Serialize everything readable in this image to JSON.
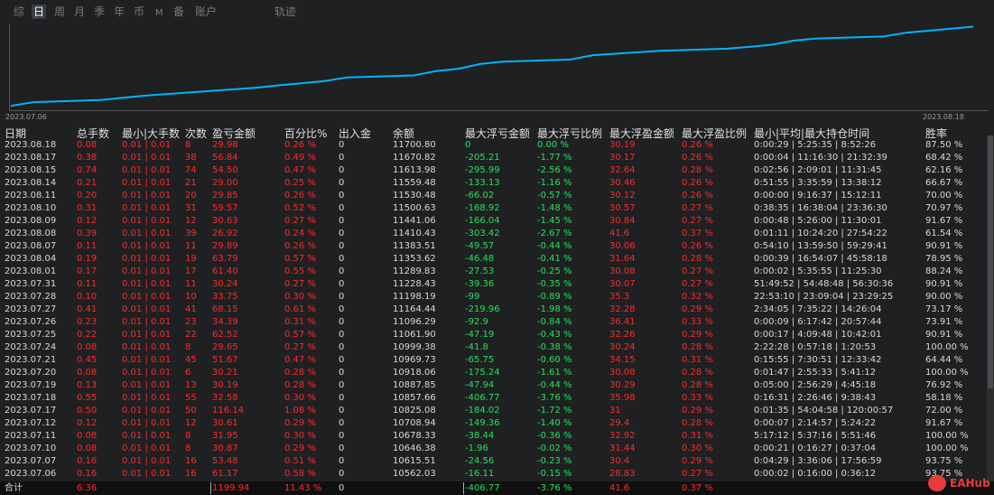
{
  "tabs": [
    "综",
    "日",
    "周",
    "月",
    "季",
    "年",
    "币",
    "M",
    "备",
    "账户",
    "轨迹"
  ],
  "active_tab": "日",
  "chart_data": {
    "type": "line",
    "x_start_label": "2023.07.06",
    "x_end_label": "2023.08.18",
    "x": [
      "2023.07.06",
      "2023.07.07",
      "2023.07.10",
      "2023.07.11",
      "2023.07.12",
      "2023.07.17",
      "2023.07.18",
      "2023.07.19",
      "2023.07.20",
      "2023.07.21",
      "2023.07.24",
      "2023.07.25",
      "2023.07.26",
      "2023.07.27",
      "2023.07.28",
      "2023.07.31",
      "2023.08.01",
      "2023.08.04",
      "2023.08.07",
      "2023.08.08",
      "2023.08.09",
      "2023.08.10",
      "2023.08.11",
      "2023.08.14",
      "2023.08.15",
      "2023.08.17",
      "2023.08.18"
    ],
    "values": [
      10562.03,
      10615.51,
      10646.38,
      10678.33,
      10708.94,
      10825.08,
      10857.66,
      10887.85,
      10918.06,
      10969.73,
      10999.38,
      11061.9,
      11096.29,
      11164.44,
      11198.19,
      11228.43,
      11289.83,
      11353.62,
      11383.51,
      11410.43,
      11441.06,
      11500.63,
      11530.48,
      11559.48,
      11613.98,
      11670.82,
      11700.8
    ],
    "line_color": "#00b4ff"
  },
  "headers": [
    "日期",
    "总手数",
    "最小|大手数",
    "次数",
    "盈亏金额",
    "百分比%",
    "出入金",
    "余额",
    "最大浮亏金额",
    "最大浮亏比例",
    "最大浮盈金额",
    "最大浮盈比例",
    "最小|平均|最大持仓时间",
    "胜率"
  ],
  "rows": [
    [
      "2023.08.18",
      "0.08",
      "0.01 | 0.01",
      "8",
      "29.98",
      "0.26 %",
      "0",
      "11700.80",
      "0",
      "0.00 %",
      "30.19",
      "0.26 %",
      "0:00:29 | 5:25:35 | 8:52:26",
      "87.50 %"
    ],
    [
      "2023.08.17",
      "0.38",
      "0.01 | 0.01",
      "38",
      "56.84",
      "0.49 %",
      "0",
      "11670.82",
      "-205.21",
      "-1.77 %",
      "30.17",
      "0.26 %",
      "0:00:04 | 11:16:30 | 21:32:39",
      "68.42 %"
    ],
    [
      "2023.08.15",
      "0.74",
      "0.01 | 0.01",
      "74",
      "54.50",
      "0.47 %",
      "0",
      "11613.98",
      "-295.99",
      "-2.56 %",
      "32.64",
      "0.28 %",
      "0:02:56 | 2:09:01 | 11:31:45",
      "62.16 %"
    ],
    [
      "2023.08.14",
      "0.21",
      "0.01 | 0.01",
      "21",
      "29.00",
      "0.25 %",
      "0",
      "11559.48",
      "-133.13",
      "-1.16 %",
      "30.46",
      "0.26 %",
      "0:51:55 | 3:35:59 | 13:38:12",
      "66.67 %"
    ],
    [
      "2023.08.11",
      "0.20",
      "0.01 | 0.01",
      "20",
      "29.85",
      "0.26 %",
      "0",
      "11530.48",
      "-66.02",
      "-0.57 %",
      "30.12",
      "0.26 %",
      "0:00:00 | 9:16:37 | 15:12:11",
      "70.00 %"
    ],
    [
      "2023.08.10",
      "0.31",
      "0.01 | 0.01",
      "31",
      "59.57",
      "0.52 %",
      "0",
      "11500.63",
      "-168.92",
      "-1.48 %",
      "30.57",
      "0.27 %",
      "0:38:35 | 16:38:04 | 23:36:30",
      "70.97 %"
    ],
    [
      "2023.08.09",
      "0.12",
      "0.01 | 0.01",
      "12",
      "30.63",
      "0.27 %",
      "0",
      "11441.06",
      "-166.04",
      "-1.45 %",
      "30.84",
      "0.27 %",
      "0:00:48 | 5:26:00 | 11:30:01",
      "91.67 %"
    ],
    [
      "2023.08.08",
      "0.39",
      "0.01 | 0.01",
      "39",
      "26.92",
      "0.24 %",
      "0",
      "11410.43",
      "-303.42",
      "-2.67 %",
      "41.6",
      "0.37 %",
      "0:01:11 | 10:24:20 | 27:54:22",
      "61.54 %"
    ],
    [
      "2023.08.07",
      "0.11",
      "0.01 | 0.01",
      "11",
      "29.89",
      "0.26 %",
      "0",
      "11383.51",
      "-49.57",
      "-0.44 %",
      "30.06",
      "0.26 %",
      "0:54:10 | 13:59:50 | 59:29:41",
      "90.91 %"
    ],
    [
      "2023.08.04",
      "0.19",
      "0.01 | 0.01",
      "19",
      "63.79",
      "0.57 %",
      "0",
      "11353.62",
      "-46.48",
      "-0.41 %",
      "31.64",
      "0.28 %",
      "0:00:39 | 16:54:07 | 45:58:18",
      "78.95 %"
    ],
    [
      "2023.08.01",
      "0.17",
      "0.01 | 0.01",
      "17",
      "61.40",
      "0.55 %",
      "0",
      "11289.83",
      "-27.53",
      "-0.25 %",
      "30.08",
      "0.27 %",
      "0:00:02 | 5:35:55 | 11:25:30",
      "88.24 %"
    ],
    [
      "2023.07.31",
      "0.11",
      "0.01 | 0.01",
      "11",
      "30.24",
      "0.27 %",
      "0",
      "11228.43",
      "-39.36",
      "-0.35 %",
      "30.07",
      "0.27 %",
      "51:49:52 | 54:48:48 | 56:30:36",
      "90.91 %"
    ],
    [
      "2023.07.28",
      "0.10",
      "0.01 | 0.01",
      "10",
      "33.75",
      "0.30 %",
      "0",
      "11198.19",
      "-99",
      "-0.89 %",
      "35.3",
      "0.32 %",
      "22:53:10 | 23:09:04 | 23:29:25",
      "90.00 %"
    ],
    [
      "2023.07.27",
      "0.41",
      "0.01 | 0.01",
      "41",
      "68.15",
      "0.61 %",
      "0",
      "11164.44",
      "-219.96",
      "-1.98 %",
      "32.28",
      "0.29 %",
      "2:34:05 | 7:35:22 | 14:26:04",
      "73.17 %"
    ],
    [
      "2023.07.26",
      "0.23",
      "0.01 | 0.01",
      "23",
      "34.39",
      "0.31 %",
      "0",
      "11096.29",
      "-92.9",
      "-0.84 %",
      "36.41",
      "0.33 %",
      "0:00:09 | 6:17:42 | 20:57:44",
      "73.91 %"
    ],
    [
      "2023.07.25",
      "0.22",
      "0.01 | 0.01",
      "22",
      "62.52",
      "0.57 %",
      "0",
      "11061.90",
      "-47.19",
      "-0.43 %",
      "32.26",
      "0.29 %",
      "0:00:17 | 4:09:48 | 10:42:01",
      "90.91 %"
    ],
    [
      "2023.07.24",
      "0.08",
      "0.01 | 0.01",
      "8",
      "29.65",
      "0.27 %",
      "0",
      "10999.38",
      "-41.8",
      "-0.38 %",
      "30.24",
      "0.28 %",
      "2:22:28 | 0:57:18 | 1:20:53",
      "100.00 %"
    ],
    [
      "2023.07.21",
      "0.45",
      "0.01 | 0.01",
      "45",
      "51.67",
      "0.47 %",
      "0",
      "10969.73",
      "-65.75",
      "-0.60 %",
      "34.15",
      "0.31 %",
      "0:15:55 | 7:30:51 | 12:33:42",
      "64.44 %"
    ],
    [
      "2023.07.20",
      "0.08",
      "0.01 | 0.01",
      "6",
      "30.21",
      "0.28 %",
      "0",
      "10918.06",
      "-175.24",
      "-1.61 %",
      "30.08",
      "0.28 %",
      "0:01:47 | 2:55:33 | 5:41:12",
      "100.00 %"
    ],
    [
      "2023.07.19",
      "0.13",
      "0.01 | 0.01",
      "13",
      "30.19",
      "0.28 %",
      "0",
      "10887.85",
      "-47.94",
      "-0.44 %",
      "30.29",
      "0.28 %",
      "0:05:00 | 2:56:29 | 4:45:18",
      "76.92 %"
    ],
    [
      "2023.07.18",
      "0.55",
      "0.01 | 0.01",
      "55",
      "32.58",
      "0.30 %",
      "0",
      "10857.66",
      "-406.77",
      "-3.76 %",
      "35.98",
      "0.33 %",
      "0:16:31 | 2:26:46 | 9:38:43",
      "58.18 %"
    ],
    [
      "2023.07.17",
      "0.50",
      "0.01 | 0.01",
      "50",
      "116.14",
      "1.08 %",
      "0",
      "10825.08",
      "-184.02",
      "-1.72 %",
      "31",
      "0.29 %",
      "0:01:35 | 54:04:58 | 120:00:57",
      "72.00 %"
    ],
    [
      "2023.07.12",
      "0.12",
      "0.01 | 0.01",
      "12",
      "30.61",
      "0.29 %",
      "0",
      "10708.94",
      "-149.36",
      "-1.40 %",
      "29.4",
      "0.28 %",
      "0:00:07 | 2:14:57 | 5:24:22",
      "91.67 %"
    ],
    [
      "2023.07.11",
      "0.08",
      "0.01 | 0.01",
      "8",
      "31.95",
      "0.30 %",
      "0",
      "10678.33",
      "-38.44",
      "-0.36 %",
      "32.92",
      "0.31 %",
      "5:17:12 | 5:37:16 | 5:51:46",
      "100.00 %"
    ],
    [
      "2023.07.10",
      "0.08",
      "0.01 | 0.01",
      "8",
      "30.87",
      "0.29 %",
      "0",
      "10646.38",
      "-1.96",
      "-0.02 %",
      "31.44",
      "0.30 %",
      "0:00:21 | 0:16:27 | 0:37:04",
      "100.00 %"
    ],
    [
      "2023.07.07",
      "0.16",
      "0.01 | 0.01",
      "16",
      "53.48",
      "0.51 %",
      "0",
      "10615.51",
      "-24.56",
      "-0.23 %",
      "30.4",
      "0.29 %",
      "0:04:29 | 3:36:06 | 17:56:59",
      "93.75 %"
    ],
    [
      "2023.07.06",
      "0.16",
      "0.01 | 0.01",
      "16",
      "61.17",
      "0.58 %",
      "0",
      "10562.03",
      "-16.11",
      "-0.15 %",
      "28.83",
      "0.27 %",
      "0:00:02 | 0:16:00 | 0:36:12",
      "93.75 %"
    ]
  ],
  "total": {
    "label": "合计",
    "lots": "6.36",
    "profit": "1199.94",
    "percent": "11.43 %",
    "deposit": "0",
    "max_float_loss": "-406.77",
    "max_float_loss_pct": "-3.76 %",
    "max_float_profit": "41.6",
    "max_float_profit_pct": "0.37 %"
  },
  "logo_text": "EAHub"
}
